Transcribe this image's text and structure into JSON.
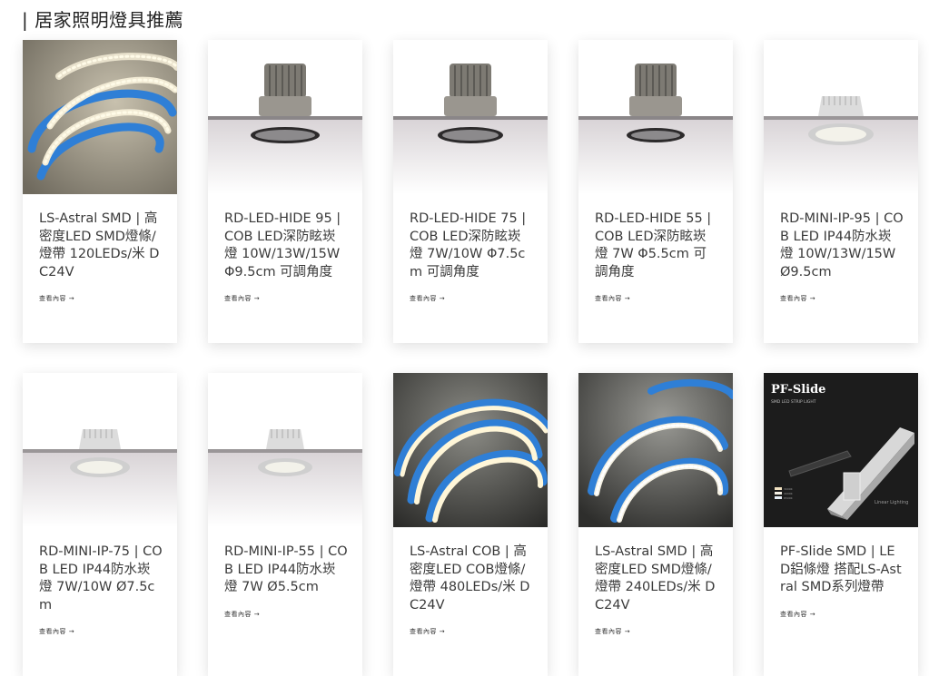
{
  "section": {
    "title": "| 居家照明燈具推薦"
  },
  "more_label": "查看內容 →",
  "products": [
    {
      "title": "LS-Astral SMD | 高密度LED SMD燈條/燈帶 120LEDs/米 DC24V",
      "image": "strip-smd-icon"
    },
    {
      "title": "RD-LED-HIDE 95 | COB LED深防眩崁燈 10W/13W/15W Φ9.5cm 可調角度",
      "image": "downlight-hide-icon"
    },
    {
      "title": "RD-LED-HIDE 75 | COB LED深防眩崁燈 7W/10W Φ7.5cm 可調角度",
      "image": "downlight-hide-icon"
    },
    {
      "title": "RD-LED-HIDE 55 | COB LED深防眩崁燈 7W Φ5.5cm 可調角度",
      "image": "downlight-hide-icon"
    },
    {
      "title": "RD-MINI-IP-95 | COB LED IP44防水崁燈 10W/13W/15W Ø9.5cm",
      "image": "downlight-mini-icon"
    },
    {
      "title": "RD-MINI-IP-75 | COB LED IP44防水崁燈 7W/10W Ø7.5cm",
      "image": "downlight-mini-icon"
    },
    {
      "title": "RD-MINI-IP-55 | COB LED IP44防水崁燈 7W Ø5.5cm",
      "image": "downlight-mini-icon"
    },
    {
      "title": "LS-Astral COB | 高密度LED COB燈條/燈帶 480LEDs/米 DC24V",
      "image": "strip-cob-icon"
    },
    {
      "title": "LS-Astral SMD | 高密度LED SMD燈條/燈帶 240LEDs/米 DC24V",
      "image": "strip-smd-dark-icon"
    },
    {
      "title": "PF-Slide SMD | LED鋁條燈 搭配LS-Astral SMD系列燈帶",
      "image": "profile-slide-icon",
      "image_text": {
        "brand": "PF-Slide",
        "sub": "SMD LED STRIP LIGHT",
        "k1": "3000K",
        "k2": "4000K",
        "k3": "6500K",
        "tag": "Linear Lighting"
      }
    }
  ],
  "colors": {
    "strip_blue": "#2f7fd6",
    "led_warm": "#fff4d2",
    "panel_dark": "#1c1c1c"
  }
}
